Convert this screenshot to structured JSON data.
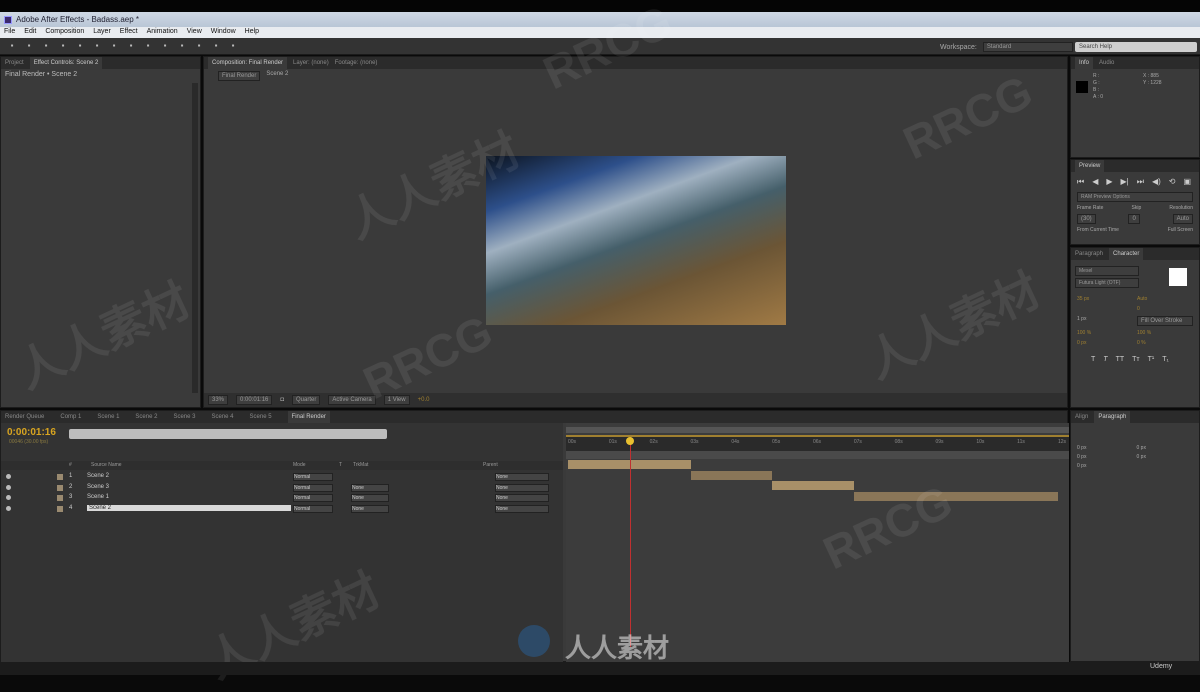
{
  "window": {
    "title": "Adobe After Effects - Badass.aep *"
  },
  "menu": [
    "File",
    "Edit",
    "Composition",
    "Layer",
    "Effect",
    "Animation",
    "View",
    "Window",
    "Help"
  ],
  "toolbar": {
    "workspace_label": "Workspace:",
    "workspace_value": "Standard",
    "help_search_placeholder": "Search Help"
  },
  "project_panel": {
    "tabs": [
      "Project",
      "Effect Controls: Scene 2"
    ],
    "breadcrumb": "Final Render • Scene 2"
  },
  "viewer": {
    "tabs": [
      "Composition: Final Render",
      "Layer: (none)",
      "Footage: (none)"
    ],
    "subtabs": [
      "Final Render",
      "Scene 2"
    ],
    "footer": {
      "zoom": "33%",
      "timecode": "0:00:01:16",
      "resolution": "Quarter",
      "camera": "Active Camera",
      "views": "1 View",
      "exposure": "+0.0"
    }
  },
  "info_panel": {
    "tabs": [
      "Info",
      "Audio"
    ],
    "rows": [
      "R :",
      "G :",
      "B :",
      "A : 0"
    ],
    "coords": [
      "X : 885",
      "Y : 1228"
    ]
  },
  "preview_panel": {
    "title": "Preview",
    "options": "RAM Preview Options",
    "frame_rate_label": "Frame Rate",
    "skip_label": "Skip",
    "resolution_label": "Resolution",
    "frame_rate": "(30)",
    "skip": "0",
    "resolution": "Auto",
    "from_current": "From Current Time",
    "full_screen": "Full Screen"
  },
  "character_panel": {
    "tabs": [
      "Paragraph",
      "Character"
    ],
    "font": "Mesel",
    "style": "Futura Light (OTF)",
    "size": "35 px",
    "leading": "Auto",
    "tracking": "0",
    "stroke": "1 px",
    "stroke_type": "Fill Over Stroke",
    "vscale": "100 %",
    "hscale": "100 %",
    "baseline": "0 px",
    "tsume": "0 %"
  },
  "paragraph_panel": {
    "tabs": [
      "Align",
      "Paragraph"
    ],
    "values": [
      "0 px",
      "0 px",
      "0 px",
      "0 px",
      "0 px"
    ]
  },
  "timeline": {
    "tabs": [
      "Render Queue",
      "Comp 1",
      "Scene 1",
      "Scene 2",
      "Scene 3",
      "Scene 4",
      "Scene 5",
      "Final Render"
    ],
    "timecode": "0:00:01:16",
    "timecode_sub": "00046 (30.00 fps)",
    "columns": [
      "#",
      "Source Name",
      "Mode",
      "T",
      "TrkMat",
      "Parent"
    ],
    "layers": [
      {
        "num": "1",
        "name": "Scene 2",
        "mode": "Normal",
        "trkmat": "",
        "parent": "None",
        "start": 0,
        "end": 3
      },
      {
        "num": "2",
        "name": "Scene 3",
        "mode": "Normal",
        "trkmat": "None",
        "parent": "None",
        "start": 3,
        "end": 5
      },
      {
        "num": "3",
        "name": "Scene 1",
        "mode": "Normal",
        "trkmat": "None",
        "parent": "None",
        "start": 5,
        "end": 7
      },
      {
        "num": "4",
        "name": "Scene 2",
        "mode": "Normal",
        "trkmat": "None",
        "parent": "None",
        "start": 7,
        "end": 12
      }
    ],
    "ruler": [
      "00s",
      "01s",
      "02s",
      "03s",
      "04s",
      "05s",
      "06s",
      "07s",
      "08s",
      "09s",
      "10s",
      "11s",
      "12s"
    ],
    "current_time_s": 1.53,
    "duration_s": 12
  },
  "watermark": [
    "RRCG",
    "人人素材"
  ],
  "footer": {
    "brand": "Udemy"
  },
  "colors": {
    "accent": "#d9a520",
    "bar1": "#a89068",
    "bar2": "#8a7658",
    "playhead": "#c03030"
  }
}
